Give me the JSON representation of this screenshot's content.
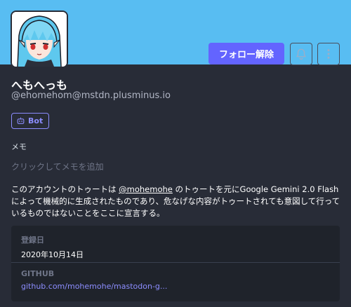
{
  "header": {
    "banner_color": "#58bdf2",
    "avatar_icon": "anime-avatar-icon"
  },
  "actions": {
    "unfollow_label": "フォロー解除",
    "bell_icon": "bell-icon",
    "menu_icon": "kebab-menu-icon"
  },
  "profile": {
    "display_name": "へもへっも",
    "acct": "@ehomehom@mstdn.plusminus.io",
    "bot_badge": "Bot",
    "memo_label": "メモ",
    "memo_placeholder": "クリックしてメモを追加",
    "bio_part1": "このアカウントのトゥートは ",
    "bio_mention": "@mohemohe",
    "bio_part2": " のトゥートを元にGoogle Gemini 2.0 Flashによって機械的に生成されたものであり、危なげな内容がトゥートされても意図して行っているものではないことをここに宣言する。"
  },
  "fields": [
    {
      "name": "登録日",
      "value": "2020年10月14日"
    },
    {
      "name": "GITHUB",
      "value": "github.com/mohemohe/mastodon-g..."
    }
  ],
  "colors": {
    "accent": "#6364ff",
    "background": "#282c37",
    "field_background": "#1f232b",
    "link": "#8c8dff"
  }
}
